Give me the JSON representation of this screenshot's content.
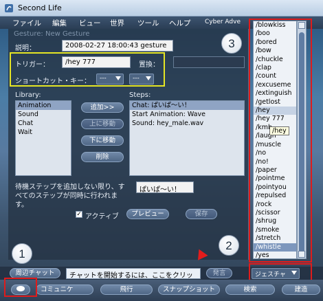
{
  "window": {
    "title": "Second Life"
  },
  "menubar": {
    "items": [
      "ファイル",
      "編集",
      "ビュー",
      "世界",
      "ツール",
      "ヘルプ"
    ],
    "right_text": "Cyber Adve"
  },
  "gesture_editor": {
    "header": "Gesture: New Gesture",
    "description_label": "説明：",
    "description_value": "2008-02-27 18:00:43 gesture",
    "trigger_label": "トリガー：",
    "trigger_value": "/hey 777",
    "replace_label": "置換：",
    "replace_value": "",
    "shortcut_label": "ショートカット・キー：",
    "shortcut_modifier": "---",
    "shortcut_key": "---",
    "library_label": "Library:",
    "library_items": [
      "Animation",
      "Sound",
      "Chat",
      "Wait"
    ],
    "library_selected": 0,
    "steps_label": "Steps:",
    "steps_items": [
      "Chat: ぱいぱ〜い！",
      "Start Animation: Wave",
      "Sound: hey_male.wav"
    ],
    "steps_selected": 0,
    "add_button": "追加>>",
    "move_up_button": "上に移動",
    "move_down_button": "下に移動",
    "delete_button": "削除",
    "note": "待機ステップを追加しない限り、すべてのステップが同時に行われます。",
    "chat_text_value": "ぱいぱ〜い！",
    "active_label": "アクティブ",
    "active_checked": true,
    "preview_button": "プレビュー",
    "save_button": "保存"
  },
  "gesture_list": {
    "items": [
      "/blowkiss",
      "/boo",
      "/bored",
      "/bow",
      "/chuckle",
      "/clap",
      "/count",
      "/excuseme",
      "/extinguish",
      "/getlost",
      "/hey",
      "/hey 777",
      "/kmb",
      "/laugh",
      "/muscle",
      "/no",
      "/no!",
      "/paper",
      "/pointme",
      "/pointyou",
      "/repulsed",
      "/rock",
      "/scissor",
      "/shrug",
      "/smoke",
      "/stretch",
      "/whistle",
      "/yes"
    ],
    "hover_index": 10,
    "selected_index": 26,
    "tooltip": "/hey"
  },
  "chatbar": {
    "local_chat_button": "周辺チャット",
    "chat_placeholder": "チャットを開始するには、ここをクリッ",
    "say_button": "発言",
    "gesture_dropdown": "ジェスチャ"
  },
  "bottombar": {
    "communicate_button": "コミュニケ",
    "fly_button": "飛行",
    "snapshot_button": "スナップショット",
    "search_button": "検索",
    "build_button": "建造"
  },
  "annotations": {
    "badge1": "1",
    "badge2": "2",
    "badge3": "3"
  },
  "colors": {
    "yellow_box": "#e6e624",
    "red_box": "#e01b1b"
  }
}
